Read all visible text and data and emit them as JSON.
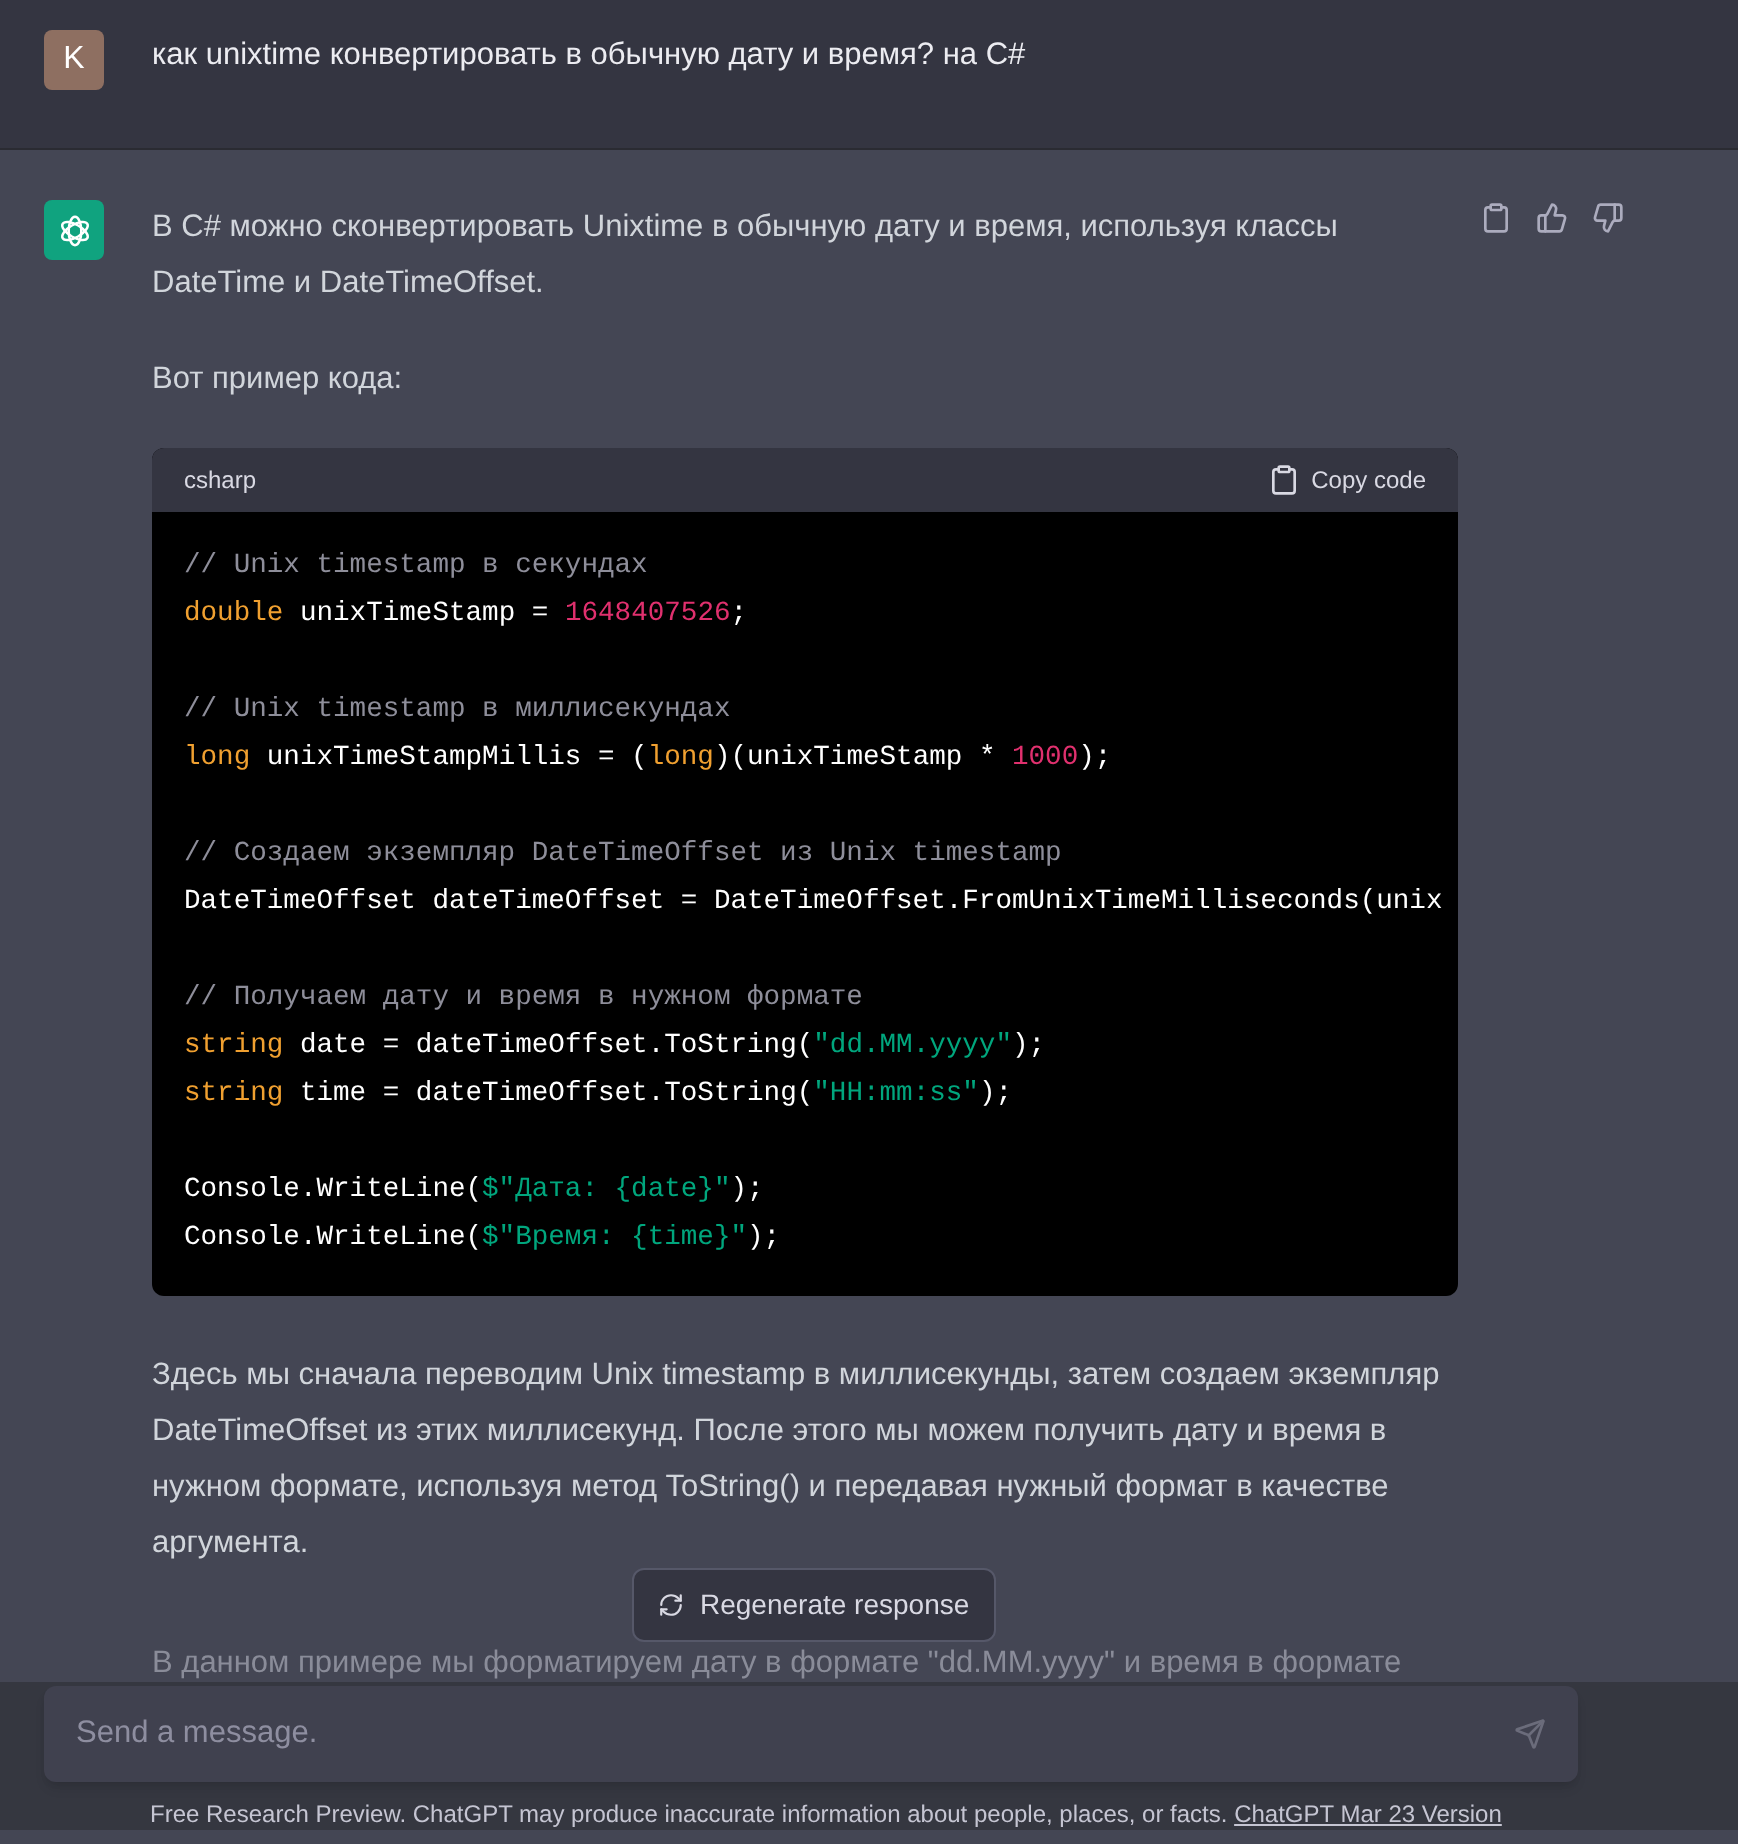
{
  "user_message": {
    "avatar": "K",
    "text": "как unixtime конвертировать в обычную дату и время? на C#"
  },
  "assistant_message": {
    "paragraphs_before": [
      "В C# можно сконвертировать Unixtime в обычную дату и время, используя классы DateTime и DateTimeOffset.",
      "Вот пример кода:"
    ],
    "code_block": {
      "language": "csharp",
      "copy_label": "Copy code",
      "groups": [
        {
          "lines": [
            [
              {
                "kind": "comment",
                "text": "// Unix timestamp в секундах"
              }
            ],
            [
              {
                "kind": "keyword",
                "text": "double"
              },
              {
                "kind": "plain",
                "text": " unixTimeStamp = "
              },
              {
                "kind": "number",
                "text": "1648407526"
              },
              {
                "kind": "plain",
                "text": ";"
              }
            ]
          ]
        },
        {
          "lines": [
            [
              {
                "kind": "comment",
                "text": "// Unix timestamp в миллисекундах"
              }
            ],
            [
              {
                "kind": "keyword",
                "text": "long"
              },
              {
                "kind": "plain",
                "text": " unixTimeStampMillis = ("
              },
              {
                "kind": "keyword",
                "text": "long"
              },
              {
                "kind": "plain",
                "text": ")(unixTimeStamp * "
              },
              {
                "kind": "number",
                "text": "1000"
              },
              {
                "kind": "plain",
                "text": ");"
              }
            ]
          ]
        },
        {
          "lines": [
            [
              {
                "kind": "comment",
                "text": "// Создаем экземпляр DateTimeOffset из Unix timestamp"
              }
            ],
            [
              {
                "kind": "plain",
                "text": "DateTimeOffset dateTimeOffset = DateTimeOffset.FromUnixTimeMilliseconds(unix"
              }
            ]
          ]
        },
        {
          "lines": [
            [
              {
                "kind": "comment",
                "text": "// Получаем дату и время в нужном формате"
              }
            ],
            [
              {
                "kind": "keyword",
                "text": "string"
              },
              {
                "kind": "plain",
                "text": " date = dateTimeOffset.ToString("
              },
              {
                "kind": "string",
                "text": "\"dd.MM.yyyy\""
              },
              {
                "kind": "plain",
                "text": ");"
              }
            ],
            [
              {
                "kind": "keyword",
                "text": "string"
              },
              {
                "kind": "plain",
                "text": " time = dateTimeOffset.ToString("
              },
              {
                "kind": "string",
                "text": "\"HH:mm:ss\""
              },
              {
                "kind": "plain",
                "text": ");"
              }
            ]
          ]
        },
        {
          "lines": [
            [
              {
                "kind": "plain",
                "text": "Console.WriteLine("
              },
              {
                "kind": "string",
                "text": "$\"Дата: {date}\""
              },
              {
                "kind": "plain",
                "text": ");"
              }
            ],
            [
              {
                "kind": "plain",
                "text": "Console.WriteLine("
              },
              {
                "kind": "string",
                "text": "$\"Время: {time}\""
              },
              {
                "kind": "plain",
                "text": ");"
              }
            ]
          ]
        }
      ]
    },
    "paragraphs_after": [
      "Здесь мы сначала переводим Unix timestamp в миллисекунды, затем создаем экземпляр DateTimeOffset из этих миллисекунд. После этого мы можем получить дату и время в нужном формате, используя метод ToString() и передавая нужный формат в качестве аргумента."
    ],
    "faded_paragraph": "В данном примере мы форматируем дату в формате \"dd.MM.yyyy\" и время в формате"
  },
  "regenerate_button": "Regenerate response",
  "message_input": {
    "placeholder": "Send a message."
  },
  "footer": {
    "text": "Free Research Preview. ChatGPT may produce inaccurate information about people, places, or facts.",
    "link": "ChatGPT Mar 23 Version"
  }
}
